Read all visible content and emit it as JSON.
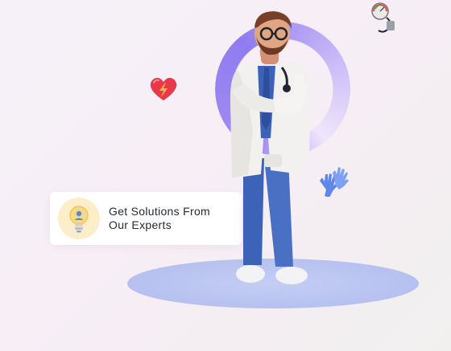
{
  "card": {
    "line1": "Get Solutions From",
    "line2": "Our Experts",
    "icon": "lightbulb-icon"
  },
  "illustrations": {
    "figure": "doctor-figure",
    "heart": "heart-icon",
    "gloves": "gloves-icon",
    "gauge": "blood-pressure-gauge-icon"
  },
  "colors": {
    "platform": "#b6c1ef",
    "ring": "#8f7cf0",
    "card_bg": "#ffffff",
    "icon_bg": "#fbeec8",
    "coat": "#f2f1ef",
    "pants": "#3d63b8",
    "heart": "#e8394a",
    "gloves": "#5f86e8"
  }
}
